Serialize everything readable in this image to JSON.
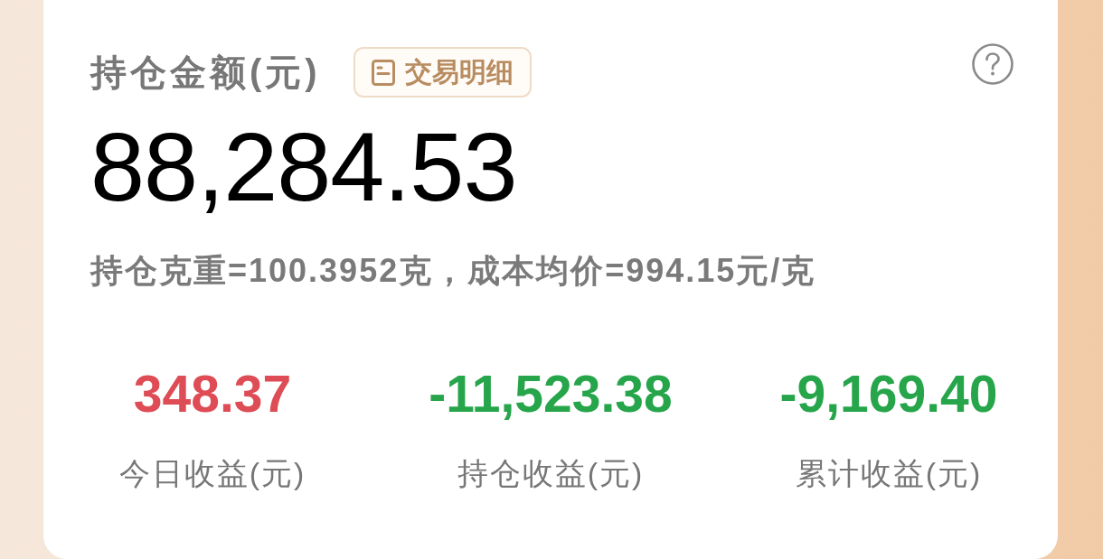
{
  "card": {
    "title": "持仓金额(元)",
    "details_button": {
      "label": "交易明细"
    },
    "amount": "88,284.53",
    "summary": "持仓克重=100.3952克，成本均价=994.15元/克",
    "stats": [
      {
        "value": "348.37",
        "color": "#de4c55",
        "label": "今日收益(元)"
      },
      {
        "value": "-11,523.38",
        "color": "#27a54b",
        "label": "持仓收益(元)"
      },
      {
        "value": "-9,169.40",
        "color": "#27a54b",
        "label": "累计收益(元)"
      }
    ]
  }
}
